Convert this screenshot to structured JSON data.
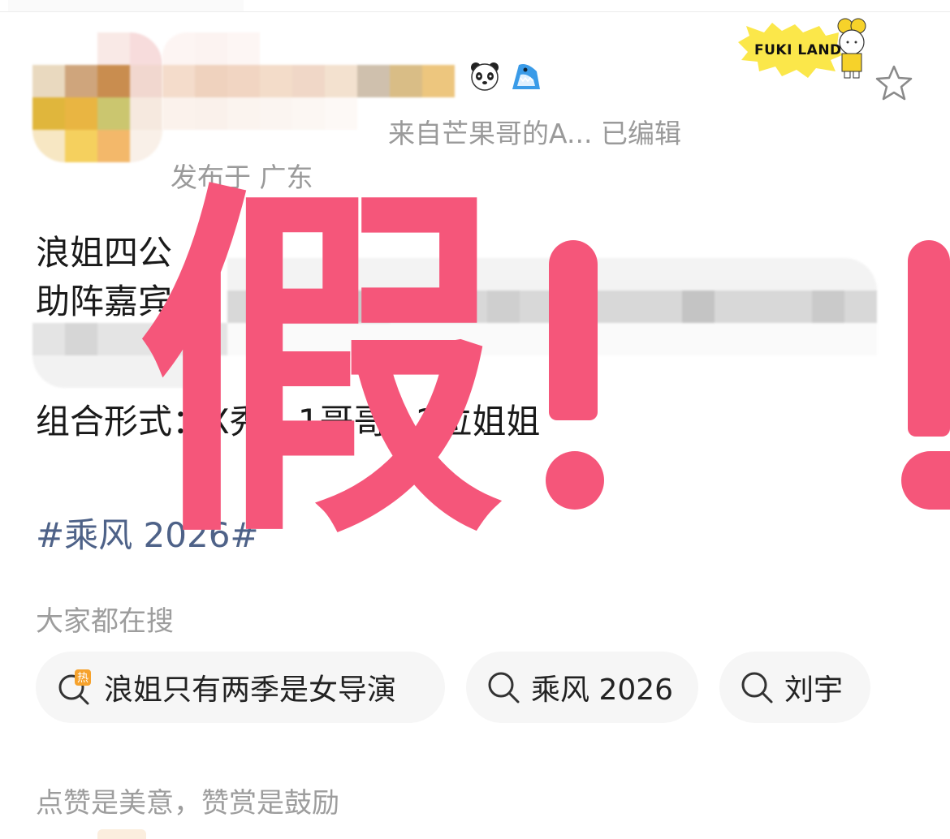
{
  "post": {
    "source": "来自芒果哥的A...  已编辑",
    "location": "发布于 广东",
    "lines": [
      "浪姐四公",
      "助阵嘉宾",
      "组合形式：X秀，1哥哥+2位姐姐"
    ],
    "hashtag": "#乘风 2026#"
  },
  "badge": {
    "text": "FUKI LAND"
  },
  "overlay": {
    "stamp_text": "假！"
  },
  "search_section": {
    "label": "大家都在搜",
    "chips": [
      {
        "label": "浪姐只有两季是女导演",
        "icon": "hot-search-icon"
      },
      {
        "label": "乘风 2026",
        "icon": "search-icon"
      },
      {
        "label": "刘宇",
        "icon": "search-icon"
      }
    ]
  },
  "reward_section": {
    "label": "点赞是美意，赞赏是鼓励"
  },
  "colors": {
    "stamp": "#f5567a",
    "hashtag": "#4e6288",
    "muted": "#9a9a9a",
    "chip_bg": "#f6f6f6"
  }
}
